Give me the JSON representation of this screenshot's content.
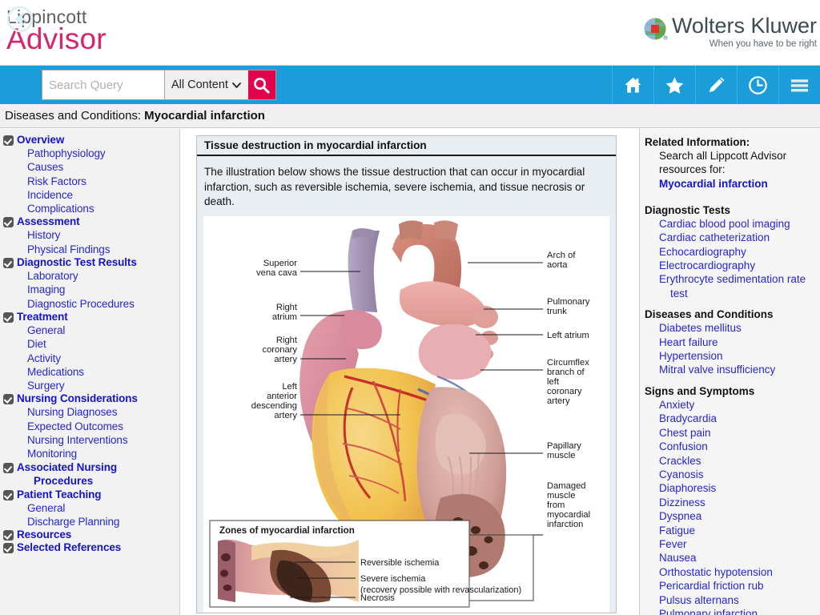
{
  "brand": {
    "line1": "Lippincott",
    "line2": "Advisor",
    "publisher": "Wolters Kluwer",
    "tagline": "When you have to be right",
    "accent_pink": "#d6246e",
    "accent_blue": "#1b9dd9",
    "search_red": "#e1044d"
  },
  "toolbar": {
    "back_icon": "back-arrow-icon",
    "search_placeholder": "Search Query",
    "search_value": "",
    "scope_selected": "All Content",
    "scope_options": [
      "All Content"
    ],
    "search_icon": "magnifier-icon",
    "buttons": [
      {
        "name": "home",
        "icon": "home-icon"
      },
      {
        "name": "favorites",
        "icon": "star-icon"
      },
      {
        "name": "notes",
        "icon": "pencil-icon"
      },
      {
        "name": "history",
        "icon": "clock-icon"
      },
      {
        "name": "menu",
        "icon": "hamburger-menu-icon"
      }
    ]
  },
  "breadcrumb": {
    "section": "Diseases and Conditions:",
    "topic": "Myocardial infarction"
  },
  "sidebar": {
    "groups": [
      {
        "label": "Overview",
        "checked": true,
        "items": [
          "Pathophysiology",
          "Causes",
          "Risk Factors",
          "Incidence",
          "Complications"
        ]
      },
      {
        "label": "Assessment",
        "checked": true,
        "items": [
          "History",
          "Physical Findings"
        ]
      },
      {
        "label": "Diagnostic Test Results",
        "checked": true,
        "items": [
          "Laboratory",
          "Imaging",
          "Diagnostic Procedures"
        ]
      },
      {
        "label": "Treatment",
        "checked": true,
        "items": [
          "General",
          "Diet",
          "Activity",
          "Medications",
          "Surgery"
        ]
      },
      {
        "label": "Nursing Considerations",
        "checked": true,
        "items": [
          "Nursing Diagnoses",
          "Expected Outcomes",
          "Nursing Interventions",
          "Monitoring"
        ]
      },
      {
        "label": "Associated Nursing",
        "label_cont": "Procedures",
        "checked": true,
        "items": []
      },
      {
        "label": "Patient Teaching",
        "checked": true,
        "items": [
          "General",
          "Discharge Planning"
        ]
      },
      {
        "label": "Resources",
        "checked": true,
        "items": []
      },
      {
        "label": "Selected References",
        "checked": true,
        "items": []
      }
    ]
  },
  "content": {
    "title": "Tissue destruction in myocardial infarction",
    "intro": "The illustration below shows the tissue destruction that can occur in myocardial infarction, such as reversible ischemia, severe ischemia, and tissue necrosis or death.",
    "figure": {
      "labels_left": [
        "Superior\nvena cava",
        "Right\natrium",
        "Right\ncoronary\nartery",
        "Left\nanterior\ndescending\nartery"
      ],
      "labels_right": [
        "Arch of\naorta",
        "Pulmonary\ntrunk",
        "Left atrium",
        "Circumflex\nbranch of\nleft\ncoronary\nartery",
        "Papillary\nmuscle",
        "Damaged\nmuscle\nfrom\nmyocardial\ninfarction"
      ],
      "inset": {
        "title": "Zones of myocardial infarction",
        "labels": [
          "Reversible ischemia",
          "Severe ischemia",
          "(recovery possible with revascularization)",
          "Necrosis"
        ]
      }
    }
  },
  "rail": {
    "related_heading": "Related Information:",
    "related_text_1": "Search all Lippcott Advisor",
    "related_text_2": "resources for:",
    "related_topic": "Myocardial infarction",
    "sections": [
      {
        "heading": "Diagnostic Tests",
        "links": [
          {
            "text": "Cardiac blood pool imaging"
          },
          {
            "text": "Cardiac catheterization"
          },
          {
            "text": "Echocardiography"
          },
          {
            "text": "Electrocardiography"
          },
          {
            "text": "Erythrocyte sedimentation rate",
            "cont": "test"
          }
        ]
      },
      {
        "heading": "Diseases and Conditions",
        "links": [
          {
            "text": "Diabetes mellitus"
          },
          {
            "text": "Heart failure"
          },
          {
            "text": "Hypertension"
          },
          {
            "text": "Mitral valve insufficiency"
          }
        ]
      },
      {
        "heading": "Signs and Symptoms",
        "links": [
          {
            "text": "Anxiety"
          },
          {
            "text": "Bradycardia"
          },
          {
            "text": "Chest pain"
          },
          {
            "text": "Confusion"
          },
          {
            "text": "Crackles"
          },
          {
            "text": "Cyanosis"
          },
          {
            "text": "Diaphoresis"
          },
          {
            "text": "Dizziness"
          },
          {
            "text": "Dyspnea"
          },
          {
            "text": "Fatigue"
          },
          {
            "text": "Fever"
          },
          {
            "text": "Nausea"
          },
          {
            "text": "Orthostatic hypotension"
          },
          {
            "text": "Pericardial friction rub"
          },
          {
            "text": "Pulsus alternans"
          },
          {
            "text": "Pulmonary infarction"
          }
        ]
      }
    ]
  }
}
